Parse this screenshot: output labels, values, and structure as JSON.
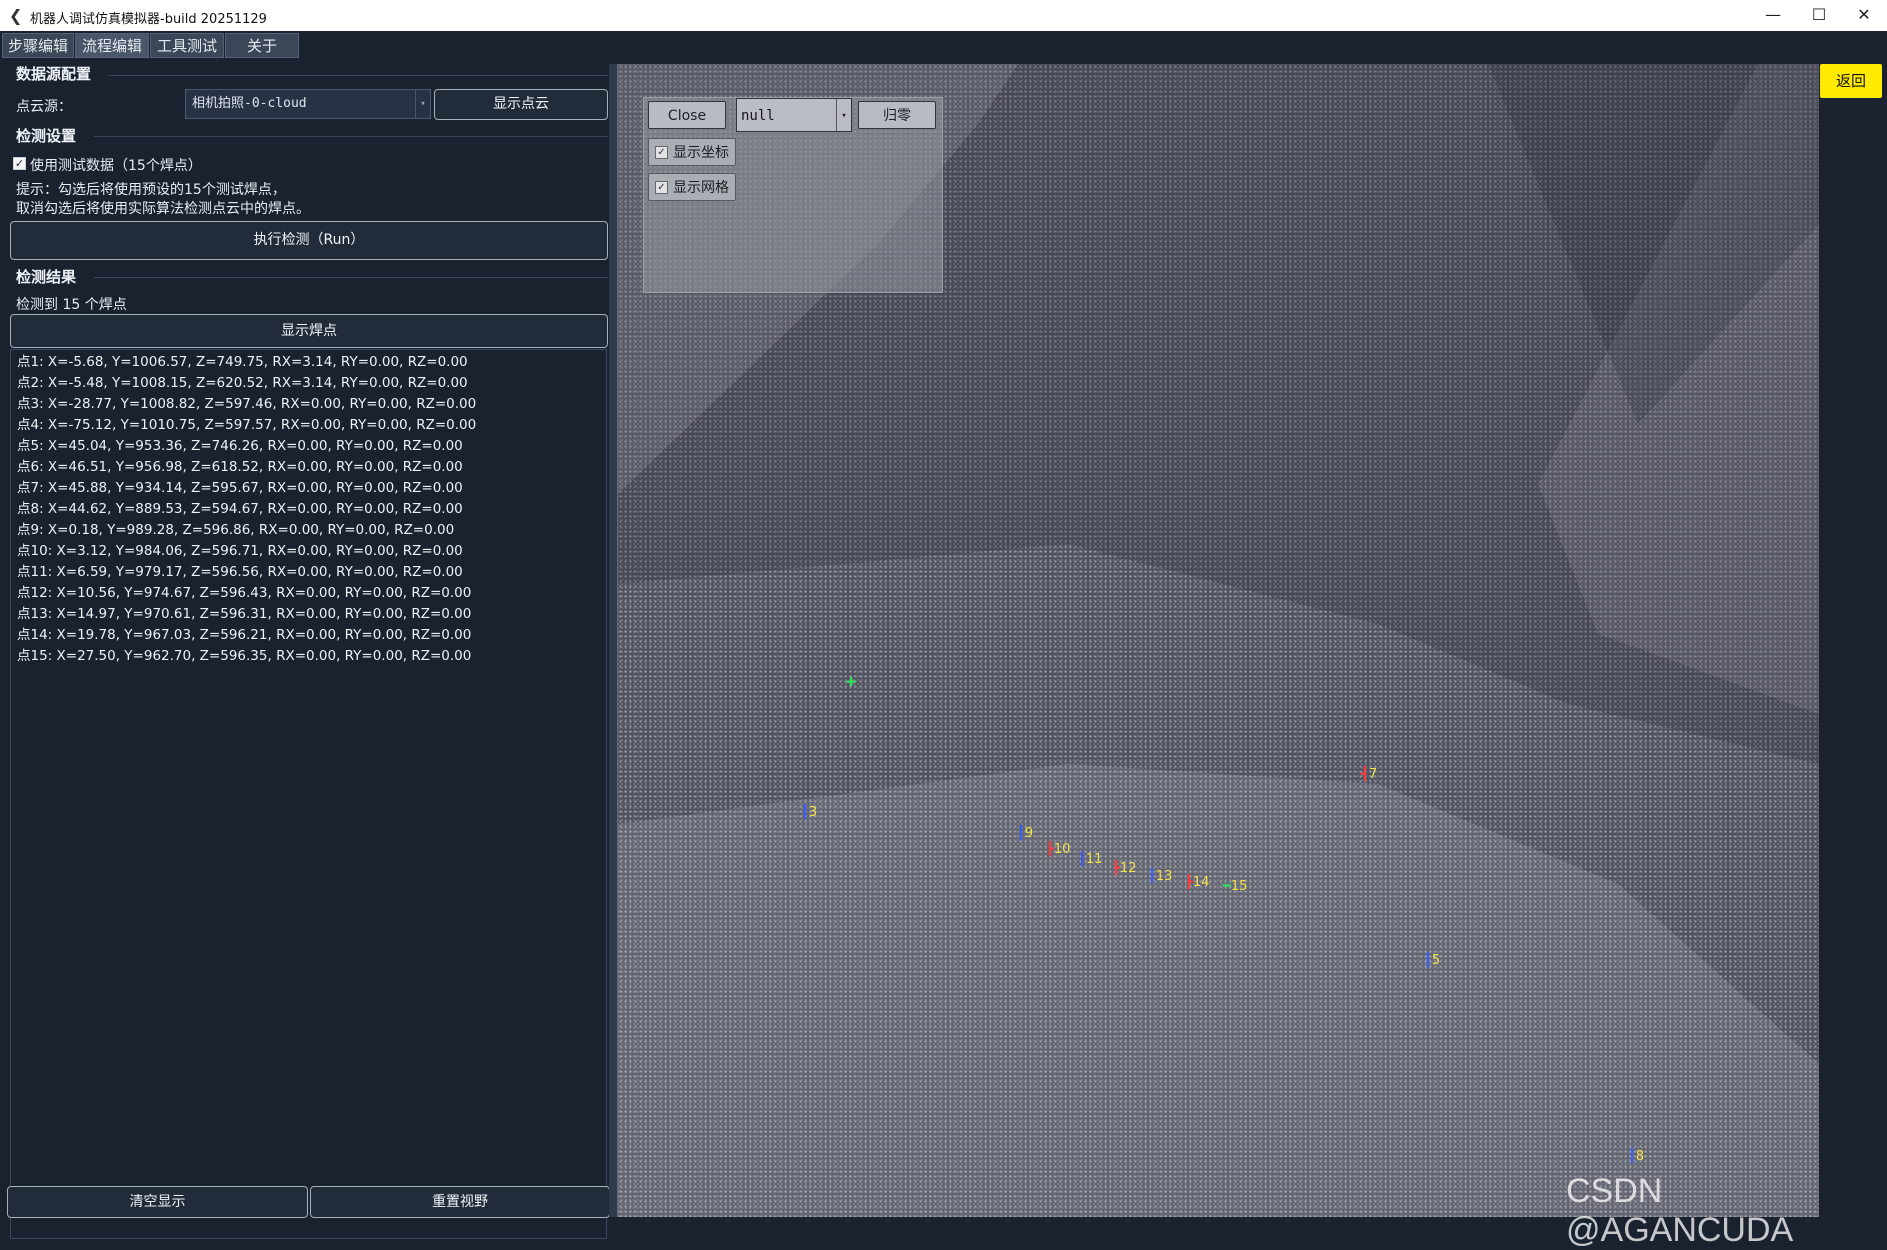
{
  "window": {
    "title": "机器人调试仿真模拟器-build 20251129",
    "minimize": "—",
    "maximize": "☐",
    "close": "✕"
  },
  "tabs": [
    {
      "label": "步骤编辑"
    },
    {
      "label": "流程编辑"
    },
    {
      "label": "工具测试"
    },
    {
      "label": "关于"
    }
  ],
  "datasource": {
    "section_title": "数据源配置",
    "cloud_label": "点云源：",
    "cloud_value": "相机拍照-0-cloud",
    "show_cloud_button": "显示点云"
  },
  "detect": {
    "section_title": "检测设置",
    "use_test_label": "使用测试数据（15个焊点）",
    "use_test_checked": "✓",
    "hint_line1": "提示：勾选后将使用预设的15个测试焊点，",
    "hint_line2": "取消勾选后将使用实际算法检测点云中的焊点。",
    "run_button": "执行检测（Run）"
  },
  "results": {
    "section_title": "检测结果",
    "count_text": "检测到 15 个焊点",
    "show_points_button": "显示焊点",
    "items": [
      "点1: X=-5.68, Y=1006.57, Z=749.75, RX=3.14, RY=0.00, RZ=0.00",
      "点2: X=-5.48, Y=1008.15, Z=620.52, RX=3.14, RY=0.00, RZ=0.00",
      "点3: X=-28.77, Y=1008.82, Z=597.46, RX=0.00, RY=0.00, RZ=0.00",
      "点4: X=-75.12, Y=1010.75, Z=597.57, RX=0.00, RY=0.00, RZ=0.00",
      "点5: X=45.04, Y=953.36, Z=746.26, RX=0.00, RY=0.00, RZ=0.00",
      "点6: X=46.51, Y=956.98, Z=618.52, RX=0.00, RY=0.00, RZ=0.00",
      "点7: X=45.88, Y=934.14, Z=595.67, RX=0.00, RY=0.00, RZ=0.00",
      "点8: X=44.62, Y=889.53, Z=594.67, RX=0.00, RY=0.00, RZ=0.00",
      "点9: X=0.18, Y=989.28, Z=596.86, RX=0.00, RY=0.00, RZ=0.00",
      "点10: X=3.12, Y=984.06, Z=596.71, RX=0.00, RY=0.00, RZ=0.00",
      "点11: X=6.59, Y=979.17, Z=596.56, RX=0.00, RY=0.00, RZ=0.00",
      "点12: X=10.56, Y=974.67, Z=596.43, RX=0.00, RY=0.00, RZ=0.00",
      "点13: X=14.97, Y=970.61, Z=596.31, RX=0.00, RY=0.00, RZ=0.00",
      "点14: X=19.78, Y=967.03, Z=596.21, RX=0.00, RY=0.00, RZ=0.00",
      "点15: X=27.50, Y=962.70, Z=596.35, RX=0.00, RY=0.00, RZ=0.00"
    ]
  },
  "bottom": {
    "clear_button": "清空显示",
    "reset_view_button": "重置视野"
  },
  "viewport": {
    "close_button": "Close",
    "select_value": "null",
    "zero_button": "归零",
    "show_axes_label": "显示坐标",
    "show_grid_label": "显示网格",
    "checked_mark": "✓",
    "back_button": "返回",
    "markers": [
      "3",
      "7",
      "9",
      "10",
      "11",
      "12",
      "13",
      "14",
      "15",
      "5",
      "8"
    ],
    "watermark": "CSDN @AGANCUDA"
  },
  "colors": {
    "background": "#1a2230",
    "back_button": "#ffea00",
    "marker_label": "#f3e24a",
    "point_cloud": "#50525f"
  }
}
